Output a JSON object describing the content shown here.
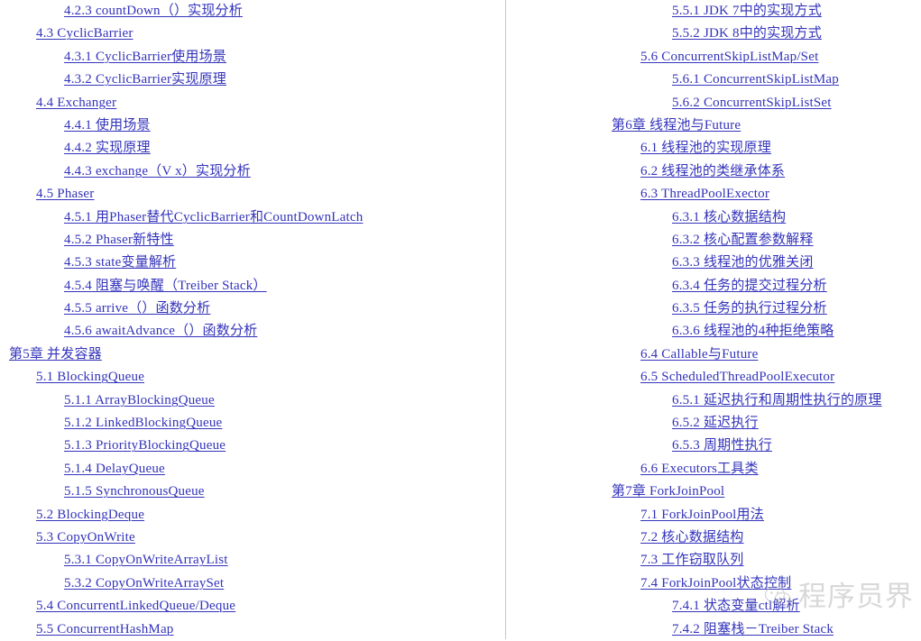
{
  "document": {
    "type": "table-of-contents",
    "link_color": "#3333bb",
    "background_color": "#ffffff",
    "divider_color": "#c8c8c8"
  },
  "left_column": {
    "entries": [
      {
        "level": 2,
        "label": "4.2.3 countDown（）实现分析"
      },
      {
        "level": 1,
        "label": "4.3 CyclicBarrier"
      },
      {
        "level": 2,
        "label": "4.3.1 CyclicBarrier使用场景"
      },
      {
        "level": 2,
        "label": "4.3.2 CyclicBarrier实现原理"
      },
      {
        "level": 1,
        "label": "4.4 Exchanger"
      },
      {
        "level": 2,
        "label": "4.4.1 使用场景"
      },
      {
        "level": 2,
        "label": "4.4.2 实现原理"
      },
      {
        "level": 2,
        "label": "4.4.3 exchange（V x）实现分析"
      },
      {
        "level": 1,
        "label": "4.5 Phaser"
      },
      {
        "level": 2,
        "label": "4.5.1 用Phaser替代CyclicBarrier和CountDownLatch"
      },
      {
        "level": 2,
        "label": "4.5.2 Phaser新特性"
      },
      {
        "level": 2,
        "label": "4.5.3 state变量解析"
      },
      {
        "level": 2,
        "label": "4.5.4 阻塞与唤醒（Treiber Stack）"
      },
      {
        "level": 2,
        "label": "4.5.5 arrive（）函数分析"
      },
      {
        "level": 2,
        "label": "4.5.6 awaitAdvance（）函数分析"
      },
      {
        "level": 0,
        "label": "第5章 并发容器"
      },
      {
        "level": 1,
        "label": "5.1 BlockingQueue"
      },
      {
        "level": 2,
        "label": "5.1.1 ArrayBlockingQueue"
      },
      {
        "level": 2,
        "label": "5.1.2 LinkedBlockingQueue"
      },
      {
        "level": 2,
        "label": "5.1.3 PriorityBlockingQueue"
      },
      {
        "level": 2,
        "label": "5.1.4 DelayQueue"
      },
      {
        "level": 2,
        "label": "5.1.5 SynchronousQueue"
      },
      {
        "level": 1,
        "label": "5.2 BlockingDeque"
      },
      {
        "level": 1,
        "label": "5.3 CopyOnWrite"
      },
      {
        "level": 2,
        "label": "5.3.1 CopyOnWriteArrayList"
      },
      {
        "level": 2,
        "label": "5.3.2 CopyOnWriteArraySet"
      },
      {
        "level": 1,
        "label": "5.4 ConcurrentLinkedQueue/Deque"
      },
      {
        "level": 1,
        "label": "5.5 ConcurrentHashMap"
      }
    ]
  },
  "right_column": {
    "entries": [
      {
        "level": 2,
        "label": "5.5.1 JDK 7中的实现方式"
      },
      {
        "level": 2,
        "label": "5.5.2 JDK 8中的实现方式"
      },
      {
        "level": 1,
        "label": "5.6 ConcurrentSkipListMap/Set"
      },
      {
        "level": 2,
        "label": "5.6.1 ConcurrentSkipListMap"
      },
      {
        "level": 2,
        "label": "5.6.2 ConcurrentSkipListSet"
      },
      {
        "level": 0,
        "label": "第6章 线程池与Future"
      },
      {
        "level": 1,
        "label": "6.1 线程池的实现原理"
      },
      {
        "level": 1,
        "label": "6.2 线程池的类继承体系"
      },
      {
        "level": 1,
        "label": "6.3 ThreadPoolExector"
      },
      {
        "level": 2,
        "label": "6.3.1 核心数据结构"
      },
      {
        "level": 2,
        "label": "6.3.2 核心配置参数解释"
      },
      {
        "level": 2,
        "label": "6.3.3 线程池的优雅关闭"
      },
      {
        "level": 2,
        "label": "6.3.4 任务的提交过程分析"
      },
      {
        "level": 2,
        "label": "6.3.5 任务的执行过程分析"
      },
      {
        "level": 2,
        "label": "6.3.6 线程池的4种拒绝策略"
      },
      {
        "level": 1,
        "label": "6.4 Callable与Future"
      },
      {
        "level": 1,
        "label": "6.5 ScheduledThreadPoolExecutor"
      },
      {
        "level": 2,
        "label": "6.5.1 延迟执行和周期性执行的原理"
      },
      {
        "level": 2,
        "label": "6.5.2 延迟执行"
      },
      {
        "level": 2,
        "label": "6.5.3 周期性执行"
      },
      {
        "level": 1,
        "label": "6.6 Executors工具类"
      },
      {
        "level": 0,
        "label": "第7章 ForkJoinPool"
      },
      {
        "level": 1,
        "label": "7.1 ForkJoinPool用法"
      },
      {
        "level": 1,
        "label": "7.2 核心数据结构"
      },
      {
        "level": 1,
        "label": "7.3 工作窃取队列"
      },
      {
        "level": 1,
        "label": "7.4 ForkJoinPool状态控制"
      },
      {
        "level": 2,
        "label": "7.4.1 状态变量ctl解析"
      },
      {
        "level": 2,
        "label": "7.4.2 阻塞栈－Treiber Stack"
      }
    ]
  },
  "watermark": {
    "icon": "wechat-icon",
    "text": "程序员界",
    "color": "#b9b9b9"
  }
}
